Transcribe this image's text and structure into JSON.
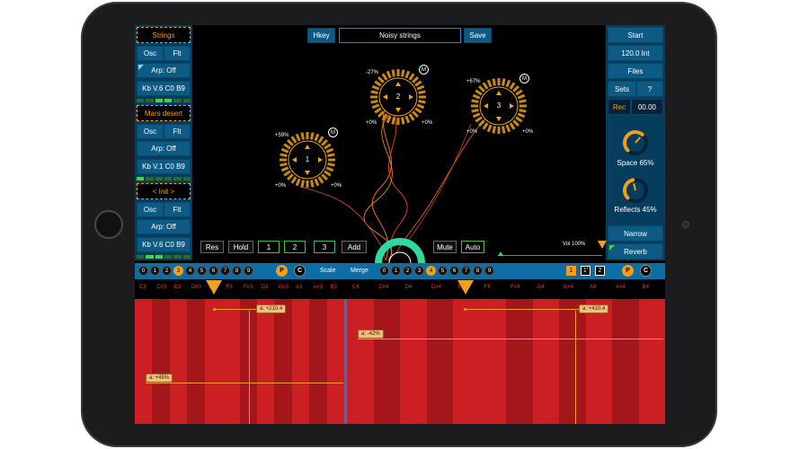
{
  "top": {
    "hkey": "Hkey",
    "preset_name": "Noisy strings",
    "save": "Save"
  },
  "left": {
    "groups": [
      {
        "name": "Strings",
        "osc": "Osc",
        "flt": "Flt",
        "arp": "Arp: Off",
        "kb": "Kb V.6 C0 B9"
      },
      {
        "name": "Mars desert",
        "osc": "Osc",
        "flt": "Flt",
        "arp": "Arp: Off",
        "kb": "Kb V.1 C0 B9"
      },
      {
        "name": "< Init >",
        "osc": "Osc",
        "flt": "Flt",
        "arp": "Arp: Off",
        "kb": "Kb V.6 C0 B9"
      }
    ]
  },
  "right": {
    "start": "Start",
    "tempo": "120.0 Int",
    "files": "Files",
    "sets": "Sets",
    "help": "?",
    "rec": "Rec",
    "time": "00.00",
    "space_label": "Space 65%",
    "space_value": 0.65,
    "reflects_label": "Reflects 45%",
    "reflects_value": 0.45,
    "narrow": "Narrow",
    "reverb": "Reverb"
  },
  "voices": [
    {
      "id": "1",
      "top_left": "+59%",
      "bottom_left": "+0%",
      "bottom_right": "+0%",
      "m": "M"
    },
    {
      "id": "2",
      "top_left": "-27%",
      "bottom_left": "+0%",
      "bottom_right": "+0%",
      "m": "M"
    },
    {
      "id": "3",
      "top_left": "+67%",
      "bottom_left": "+0%",
      "bottom_right": "+0%",
      "m": "M"
    }
  ],
  "controls": {
    "res": "Res",
    "hold": "Hold",
    "n1": "1",
    "n2": "2",
    "n3": "3",
    "add": "Add",
    "mute": "Mute",
    "auto": "Auto",
    "vol": "Vol 100%",
    "vol_value": 1.0
  },
  "scale_bar": {
    "scale": "Scale",
    "merge": "Merge",
    "left_notes": [
      "0",
      "1",
      "2",
      "3",
      "4",
      "5",
      "6",
      "7",
      "8",
      "9"
    ],
    "left_active": [
      3
    ],
    "right_notes": [
      "0",
      "1",
      "2",
      "3",
      "4",
      "5",
      "6",
      "7",
      "8",
      "9"
    ],
    "right_active": [
      4
    ],
    "p": "P",
    "c": "C",
    "boxes": [
      "1",
      "1'",
      "2"
    ]
  },
  "note_names_left": [
    "C3",
    "C#3",
    "D3",
    "D#3",
    "E3",
    "F3",
    "F#3",
    "G3",
    "G#3",
    "A3",
    "A#3",
    "B3"
  ],
  "note_names_right": [
    "C4",
    "C#4",
    "D4",
    "D#4",
    "E4",
    "F4",
    "F#4",
    "G4",
    "G#4",
    "A4",
    "A#4",
    "B4"
  ],
  "tags": {
    "left_top": "a: +210.4",
    "left_mid": "a: +45%",
    "right_top": "a: +410.4",
    "right_mid": "a: -42%"
  },
  "colors": {
    "accent": "#f0a01c",
    "panel": "#0d5b85",
    "key_red": "#cc1f24",
    "green": "#3fbf3f"
  }
}
